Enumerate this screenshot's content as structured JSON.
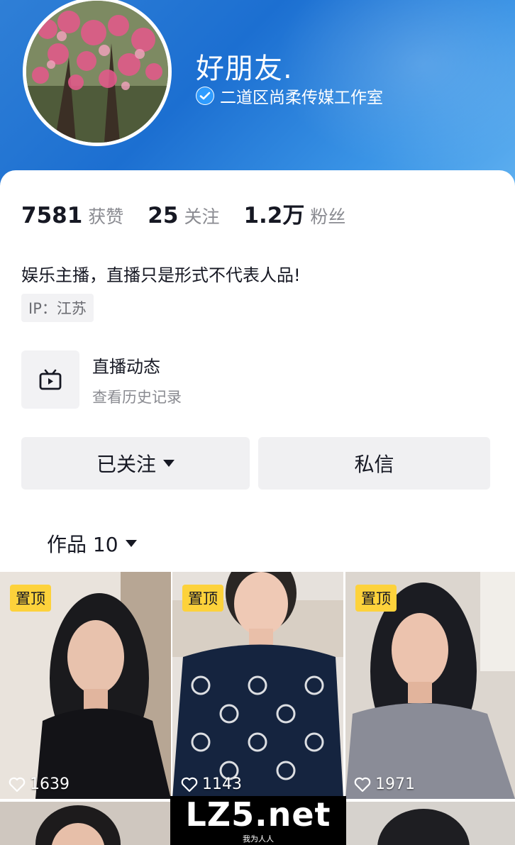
{
  "profile": {
    "nickname": "好朋友.",
    "verified_label": "二道区尚柔传媒工作室"
  },
  "stats": [
    {
      "value": "7581",
      "label": "获赞"
    },
    {
      "value": "25",
      "label": "关注"
    },
    {
      "value": "1.2万",
      "label": "粉丝"
    }
  ],
  "bio": "娱乐主播，直播只是形式不代表人品!",
  "ip_tag": "IP：江苏",
  "live": {
    "title": "直播动态",
    "subtitle": "查看历史记录",
    "icon": "tv-icon"
  },
  "buttons": {
    "followed": "已关注",
    "message": "私信"
  },
  "works_tab": "作品 10",
  "videos": [
    {
      "pin": "置顶",
      "likes": "1639"
    },
    {
      "pin": "置顶",
      "likes": "1143"
    },
    {
      "pin": "置顶",
      "likes": "1971"
    }
  ],
  "watermark": {
    "main": "LZ5.net",
    "sub": "我为人人"
  },
  "colors": {
    "banner": "#1c6fd1",
    "pin_badge": "#fdd23b",
    "button_bg": "#f0f0f2"
  }
}
